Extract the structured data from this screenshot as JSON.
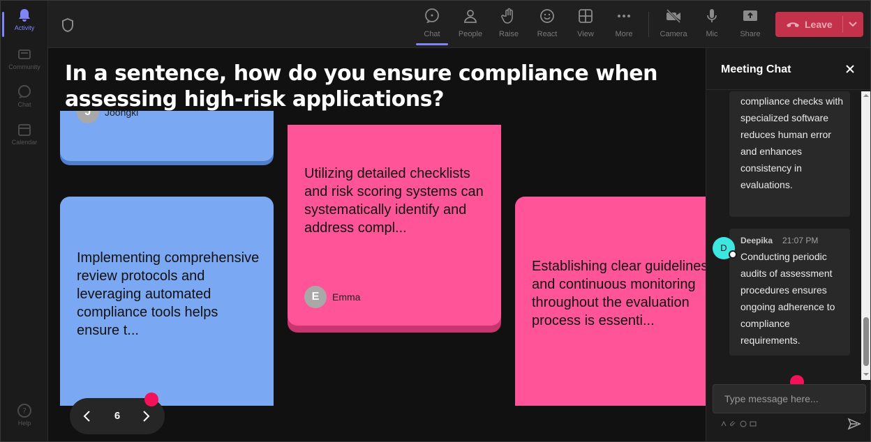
{
  "rail": {
    "items": [
      {
        "label": "Activity",
        "active": true
      },
      {
        "label": "Community"
      },
      {
        "label": "Chat"
      },
      {
        "label": "Calendar"
      }
    ],
    "help": "Help"
  },
  "toolbar": {
    "items": [
      {
        "label": "Chat",
        "icon": "chat-icon",
        "active": true
      },
      {
        "label": "People",
        "icon": "people-icon"
      },
      {
        "label": "Raise",
        "icon": "raise-hand-icon"
      },
      {
        "label": "React",
        "icon": "react-icon"
      },
      {
        "label": "View",
        "icon": "view-icon"
      },
      {
        "label": "More",
        "icon": "more-icon"
      },
      {
        "label": "Camera",
        "icon": "camera-off-icon"
      },
      {
        "label": "Mic",
        "icon": "mic-icon"
      },
      {
        "label": "Share",
        "icon": "share-icon"
      }
    ],
    "leave_label": "Leave",
    "leave_color": "#c4314b"
  },
  "stage": {
    "question": "In a sentence, how do you ensure compliance when assessing high-risk applications?",
    "cards": [
      {
        "author": "Joongki",
        "initial": "J",
        "color": "#7ba8f2"
      },
      {
        "text": "Utilizing detailed checklists and risk scoring systems can systematically identify and address compl...",
        "author": "Emma",
        "initial": "E",
        "color": "#ff5497"
      },
      {
        "text": "Implementing comprehensive review protocols and leveraging automated compliance tools helps ensure t...",
        "color": "#7ba8f2"
      },
      {
        "text": "Establishing clear guidelines and continuous monitoring throughout the evaluation process is essenti...",
        "color": "#ff5497"
      }
    ],
    "page": "6"
  },
  "chat": {
    "title": "Meeting Chat",
    "messages": [
      {
        "text": "compliance checks with specialized software reduces human error and enhances consistency in evaluations."
      },
      {
        "author": "Deepika",
        "initial": "D",
        "time": "21:07 PM",
        "text": "Conducting periodic audits of assessment procedures ensures ongoing adherence to compliance requirements."
      }
    ],
    "input_placeholder": "Type message here..."
  },
  "colors": {
    "accent": "#7f85f5",
    "notification": "#f5105a"
  }
}
